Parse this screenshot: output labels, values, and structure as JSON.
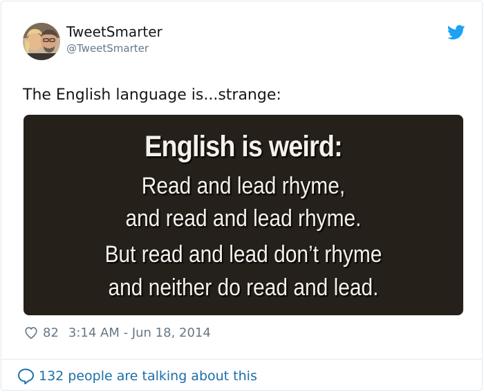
{
  "author": {
    "display_name": "TweetSmarter",
    "handle": "@TweetSmarter"
  },
  "tweet": {
    "text": "The English language is...strange:",
    "image_text": {
      "headline": "English is weird:",
      "lines": [
        "Read and lead rhyme,",
        "and read and lead rhyme.",
        "But read and lead don’t rhyme",
        "and neither do read and lead."
      ]
    },
    "like_count": "82",
    "timestamp": "3:14 AM - Jun 18, 2014",
    "conversation_text": "132 people are talking about this"
  },
  "icons": {
    "brand": "twitter-bird-icon",
    "like": "heart-icon",
    "conversation": "speech-bubble-icon"
  },
  "colors": {
    "brand": "#1da1f2",
    "link": "#1b6fa8",
    "muted": "#657786",
    "text": "#14171a",
    "media_background": "#26201b"
  }
}
